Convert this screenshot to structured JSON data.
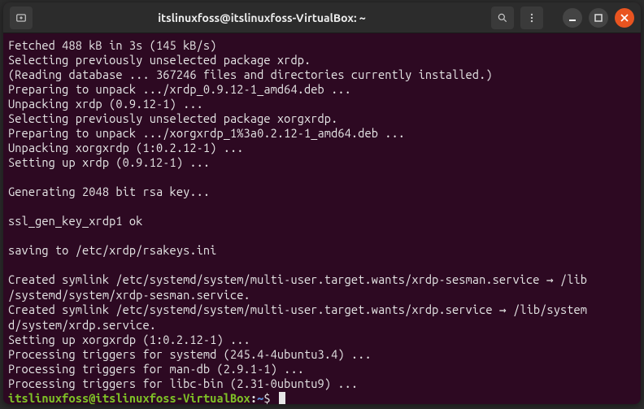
{
  "window": {
    "title": "itslinuxfoss@itslinuxfoss-VirtualBox: ~"
  },
  "terminal": {
    "lines": {
      "l0": "Fetched 488 kB in 3s (145 kB/s)",
      "l1": "Selecting previously unselected package xrdp.",
      "l2": "(Reading database ... 367246 files and directories currently installed.)",
      "l3": "Preparing to unpack .../xrdp_0.9.12-1_amd64.deb ...",
      "l4": "Unpacking xrdp (0.9.12-1) ...",
      "l5": "Selecting previously unselected package xorgxrdp.",
      "l6": "Preparing to unpack .../xorgxrdp_1%3a0.2.12-1_amd64.deb ...",
      "l7": "Unpacking xorgxrdp (1:0.2.12-1) ...",
      "l8": "Setting up xrdp (0.9.12-1) ...",
      "l9": "",
      "l10": "Generating 2048 bit rsa key...",
      "l11": "",
      "l12": "ssl_gen_key_xrdp1 ok",
      "l13": "",
      "l14": "saving to /etc/xrdp/rsakeys.ini",
      "l15": "",
      "l16a": "Created symlink /etc/systemd/system/multi-user.target.wants/xrdp-sesman.service ",
      "l16arrow": "→",
      "l16b": " /lib",
      "l17": "/systemd/system/xrdp-sesman.service.",
      "l18a": "Created symlink /etc/systemd/system/multi-user.target.wants/xrdp.service ",
      "l18arrow": "→",
      "l18b": " /lib/system",
      "l19": "d/system/xrdp.service.",
      "l20": "Setting up xorgxrdp (1:0.2.12-1) ...",
      "l21": "Processing triggers for systemd (245.4-4ubuntu3.4) ...",
      "l22": "Processing triggers for man-db (2.9.1-1) ...",
      "l23": "Processing triggers for libc-bin (2.31-0ubuntu9) ..."
    },
    "prompt": {
      "user_host": "itslinuxfoss@itslinuxfoss-VirtualBox",
      "colon": ":",
      "path": "~",
      "dollar": "$"
    }
  }
}
